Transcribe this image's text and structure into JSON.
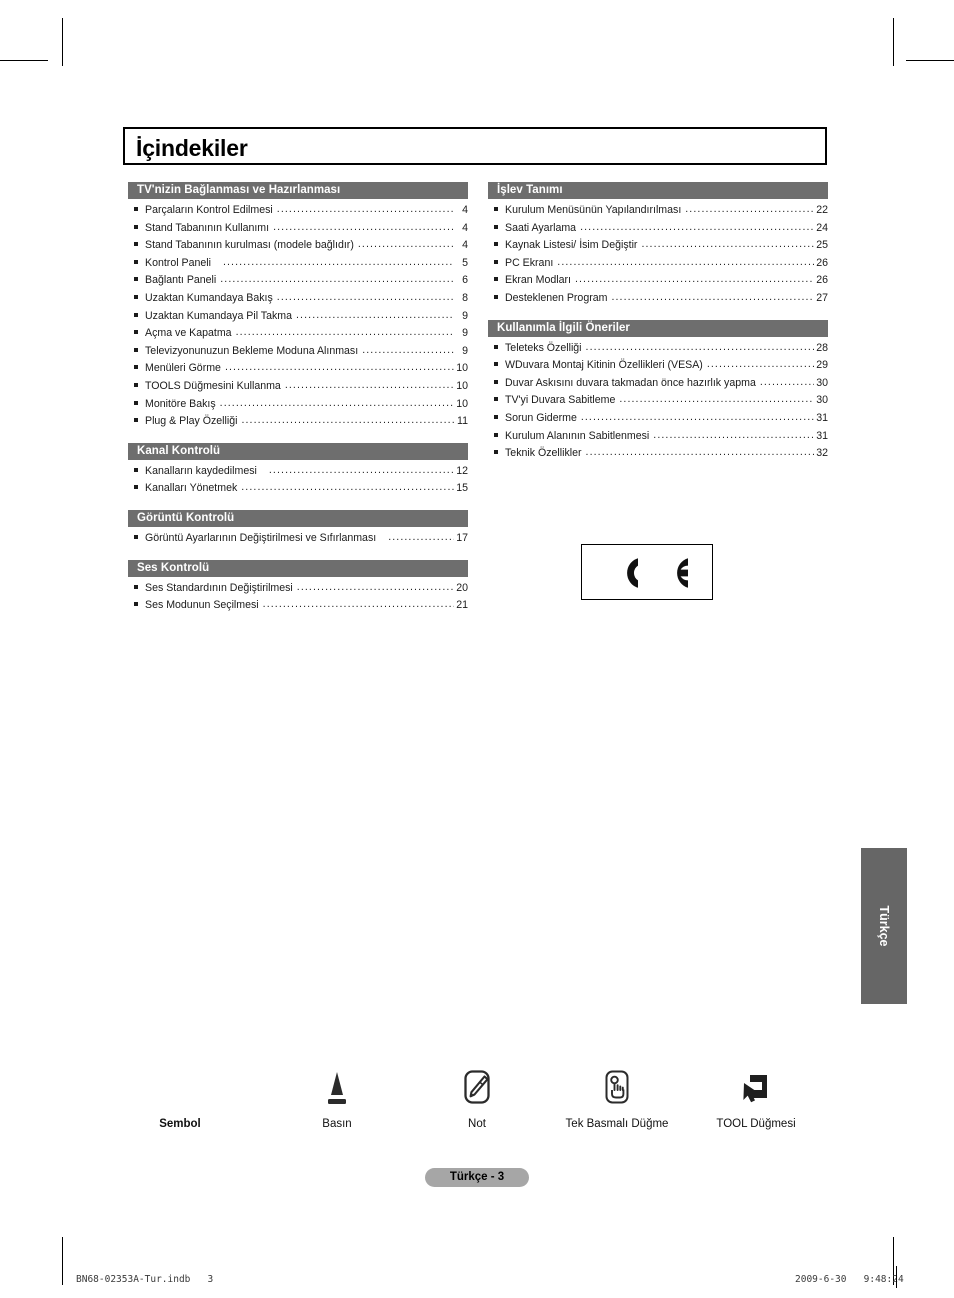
{
  "page": {
    "title": "İçindekiler",
    "page_label": "Türkçe - 3",
    "side_tab_label": "Türkçe",
    "footer_left": "BN68-02353A-Tur.indb   3",
    "footer_right": "2009-6-30   9:48:24",
    "ce_mark_alt": "CE"
  },
  "toc": {
    "left_column": [
      {
        "heading": "TV'nizin Bağlanması ve Hazırlanması",
        "entries": [
          {
            "text": "Parçaların Kontrol Edilmesi",
            "page": "4"
          },
          {
            "text": "Stand Tabanının Kullanımı",
            "page": "4"
          },
          {
            "text": "Stand Tabanının kurulması (modele bağlıdır)",
            "page": "4"
          },
          {
            "text": "Kontrol Paneli",
            "page": "5",
            "gap": true
          },
          {
            "text": "Bağlantı Paneli",
            "page": "6"
          },
          {
            "text": "Uzaktan Kumandaya Bakış",
            "page": "8"
          },
          {
            "text": "Uzaktan Kumandaya Pil Takma",
            "page": "9"
          },
          {
            "text": "Açma ve Kapatma",
            "page": "9"
          },
          {
            "text": "Televizyonunuzun Bekleme Moduna Alınması",
            "page": "9"
          },
          {
            "text": "Menüleri Görme",
            "page": "10"
          },
          {
            "text": "TOOLS Düğmesini Kullanma",
            "page": "10"
          },
          {
            "text": "Monitöre Bakış",
            "page": "10"
          },
          {
            "text": "Plug & Play Özelliği",
            "page": "11"
          }
        ]
      },
      {
        "heading": "Kanal Kontrolü",
        "entries": [
          {
            "text": "Kanalların kaydedilmesi",
            "page": "12",
            "gap": true
          },
          {
            "text": "Kanalları Yönetmek",
            "page": "15"
          }
        ]
      },
      {
        "heading": "Görüntü Kontrolü",
        "entries": [
          {
            "text": "Görüntü Ayarlarının Değiştirilmesi ve Sıfırlanması",
            "page": "17",
            "gap": true
          }
        ]
      },
      {
        "heading": "Ses Kontrolü",
        "entries": [
          {
            "text": "Ses Standardının Değiştirilmesi",
            "page": "20"
          },
          {
            "text": "Ses Modunun Seçilmesi",
            "page": "21"
          }
        ]
      }
    ],
    "right_column": [
      {
        "heading": "İşlev Tanımı",
        "entries": [
          {
            "text": "Kurulum Menüsünün Yapılandırılması",
            "page": "22"
          },
          {
            "text": "Saati Ayarlama",
            "page": "24"
          },
          {
            "text": "Kaynak Listesi/ İsim Değiştir",
            "page": "25"
          },
          {
            "text": "PC Ekranı",
            "page": "26"
          },
          {
            "text": "Ekran Modları",
            "page": "26"
          },
          {
            "text": "Desteklenen Program",
            "page": "27"
          }
        ]
      },
      {
        "heading": "Kullanımla İlgili Öneriler",
        "entries": [
          {
            "text": "Teleteks Özelliği",
            "page": "28"
          },
          {
            "text": "WDuvara Montaj Kitinin Özellikleri (VESA)",
            "page": "29"
          },
          {
            "text": "Duvar Askısını duvara takmadan önce hazırlık yapma",
            "page": "30"
          },
          {
            "text": "TV'yi Duvara Sabitleme",
            "page": "30"
          },
          {
            "text": "Sorun Giderme",
            "page": "31"
          },
          {
            "text": "Kurulum Alanının Sabitlenmesi",
            "page": "31"
          },
          {
            "text": "Teknik Özellikler",
            "page": "32"
          }
        ]
      }
    ]
  },
  "symbols": {
    "title_label": "Sembol",
    "items": [
      {
        "label": "Basın",
        "icon": "press-triangle-icon"
      },
      {
        "label": "Not",
        "icon": "note-pencil-icon"
      },
      {
        "label": "Tek Basmalı Düğme",
        "icon": "one-touch-hand-icon"
      },
      {
        "label": "TOOL Düğmesi",
        "icon": "tool-cursor-window-icon"
      }
    ]
  },
  "colors": {
    "section_header_bg": "#6e6e6e",
    "side_tab_bg": "#666666",
    "page_pill_bg": "#a6a6a6",
    "text": "#1b1b1b"
  }
}
